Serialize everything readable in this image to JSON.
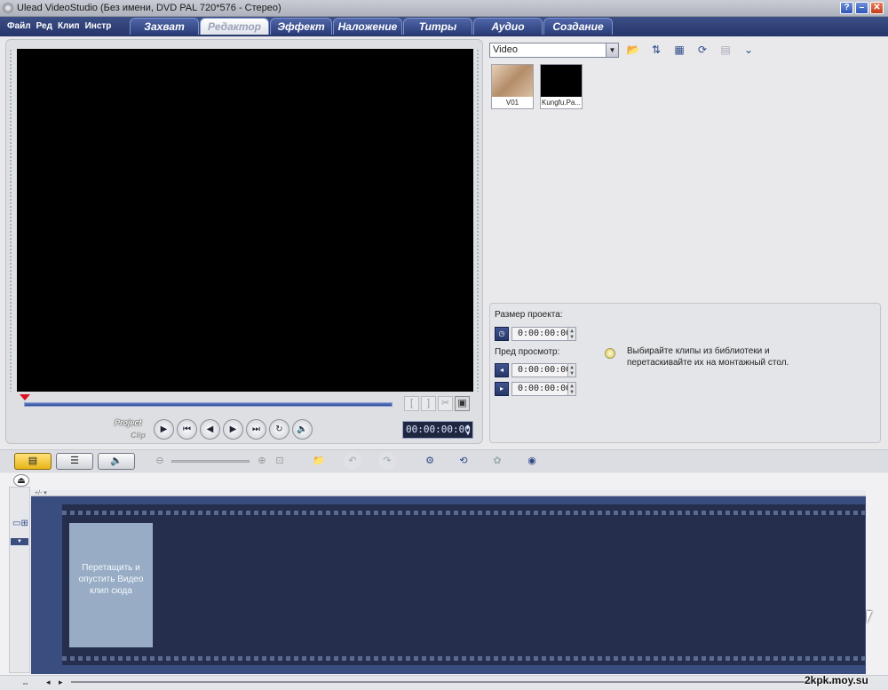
{
  "window": {
    "title": "Ulead VideoStudio (Без имени, DVD PAL 720*576 - Стерео)",
    "help_label": "?",
    "minimize_label": "–",
    "close_label": "✕"
  },
  "menu": [
    "Файл",
    "Ред",
    "Клип",
    "Инстр"
  ],
  "tabs": [
    {
      "label": "Захват",
      "active": false
    },
    {
      "label": "Редактор",
      "active": true
    },
    {
      "label": "Эффект",
      "active": false
    },
    {
      "label": "Наложение",
      "active": false
    },
    {
      "label": "Титры",
      "active": false
    },
    {
      "label": "Аудио",
      "active": false
    },
    {
      "label": "Создание",
      "active": false
    }
  ],
  "preview": {
    "mode_project": "Project",
    "mode_clip": "Clip",
    "timecode": "00:00:00:00",
    "trim_start": "[",
    "trim_end": "]",
    "split_icon": "scissors-icon",
    "fullscreen_icon": "fullscreen-icon",
    "transport": [
      {
        "name": "play-button",
        "glyph": "▶"
      },
      {
        "name": "home-button",
        "glyph": "⏮"
      },
      {
        "name": "previous-frame-button",
        "glyph": "◀"
      },
      {
        "name": "next-frame-button",
        "glyph": "▶"
      },
      {
        "name": "end-button",
        "glyph": "⏭"
      },
      {
        "name": "repeat-button",
        "glyph": "↻"
      },
      {
        "name": "volume-button",
        "glyph": "🔈"
      }
    ]
  },
  "library": {
    "category": "Video",
    "tools": [
      {
        "name": "open-folder-icon",
        "glyph": "📂"
      },
      {
        "name": "sort-icon",
        "glyph": "⇅"
      },
      {
        "name": "library-manager-icon",
        "glyph": "▦"
      },
      {
        "name": "refresh-icon",
        "glyph": "⟳"
      },
      {
        "name": "properties-icon",
        "glyph": "▤"
      },
      {
        "name": "expand-icon",
        "glyph": "⌄"
      }
    ],
    "clips": [
      {
        "label": "V01",
        "thumb_color": "#c9a98a"
      },
      {
        "label": "Kungfu.Pa...",
        "thumb_color": "#000000"
      }
    ]
  },
  "options": {
    "project_size_label": "Размер проекта:",
    "project_size_value": "0:00:00:00",
    "preview_label": "Пред просмотр:",
    "preview_start_value": "0:00:00:00",
    "preview_end_value": "0:00:00:00",
    "hint": "Выбирайте клипы из библиотеки и перетаскивайте их на монтажный стол."
  },
  "timeline_toolbar": {
    "views": [
      {
        "name": "storyboard-view-button",
        "glyph": "▤",
        "active": true
      },
      {
        "name": "timeline-view-button",
        "glyph": "☰",
        "active": false
      },
      {
        "name": "audio-view-button",
        "glyph": "🔈",
        "active": false
      }
    ],
    "tools": [
      {
        "name": "insert-media-icon",
        "glyph": "📁"
      },
      {
        "name": "undo-icon",
        "glyph": "↶"
      },
      {
        "name": "redo-icon",
        "glyph": "↷"
      },
      {
        "name": "smart-proxy-icon",
        "glyph": "⚙"
      },
      {
        "name": "batch-convert-icon",
        "glyph": "⟲"
      },
      {
        "name": "chapter-icon",
        "glyph": "✿"
      },
      {
        "name": "create-disc-icon",
        "glyph": "◉"
      }
    ]
  },
  "timeline": {
    "ruler": "+/- ▾",
    "dropzone_text": "Перетащить и опустить Видео клип сюда"
  },
  "watermark": "2kpk.moy.su"
}
